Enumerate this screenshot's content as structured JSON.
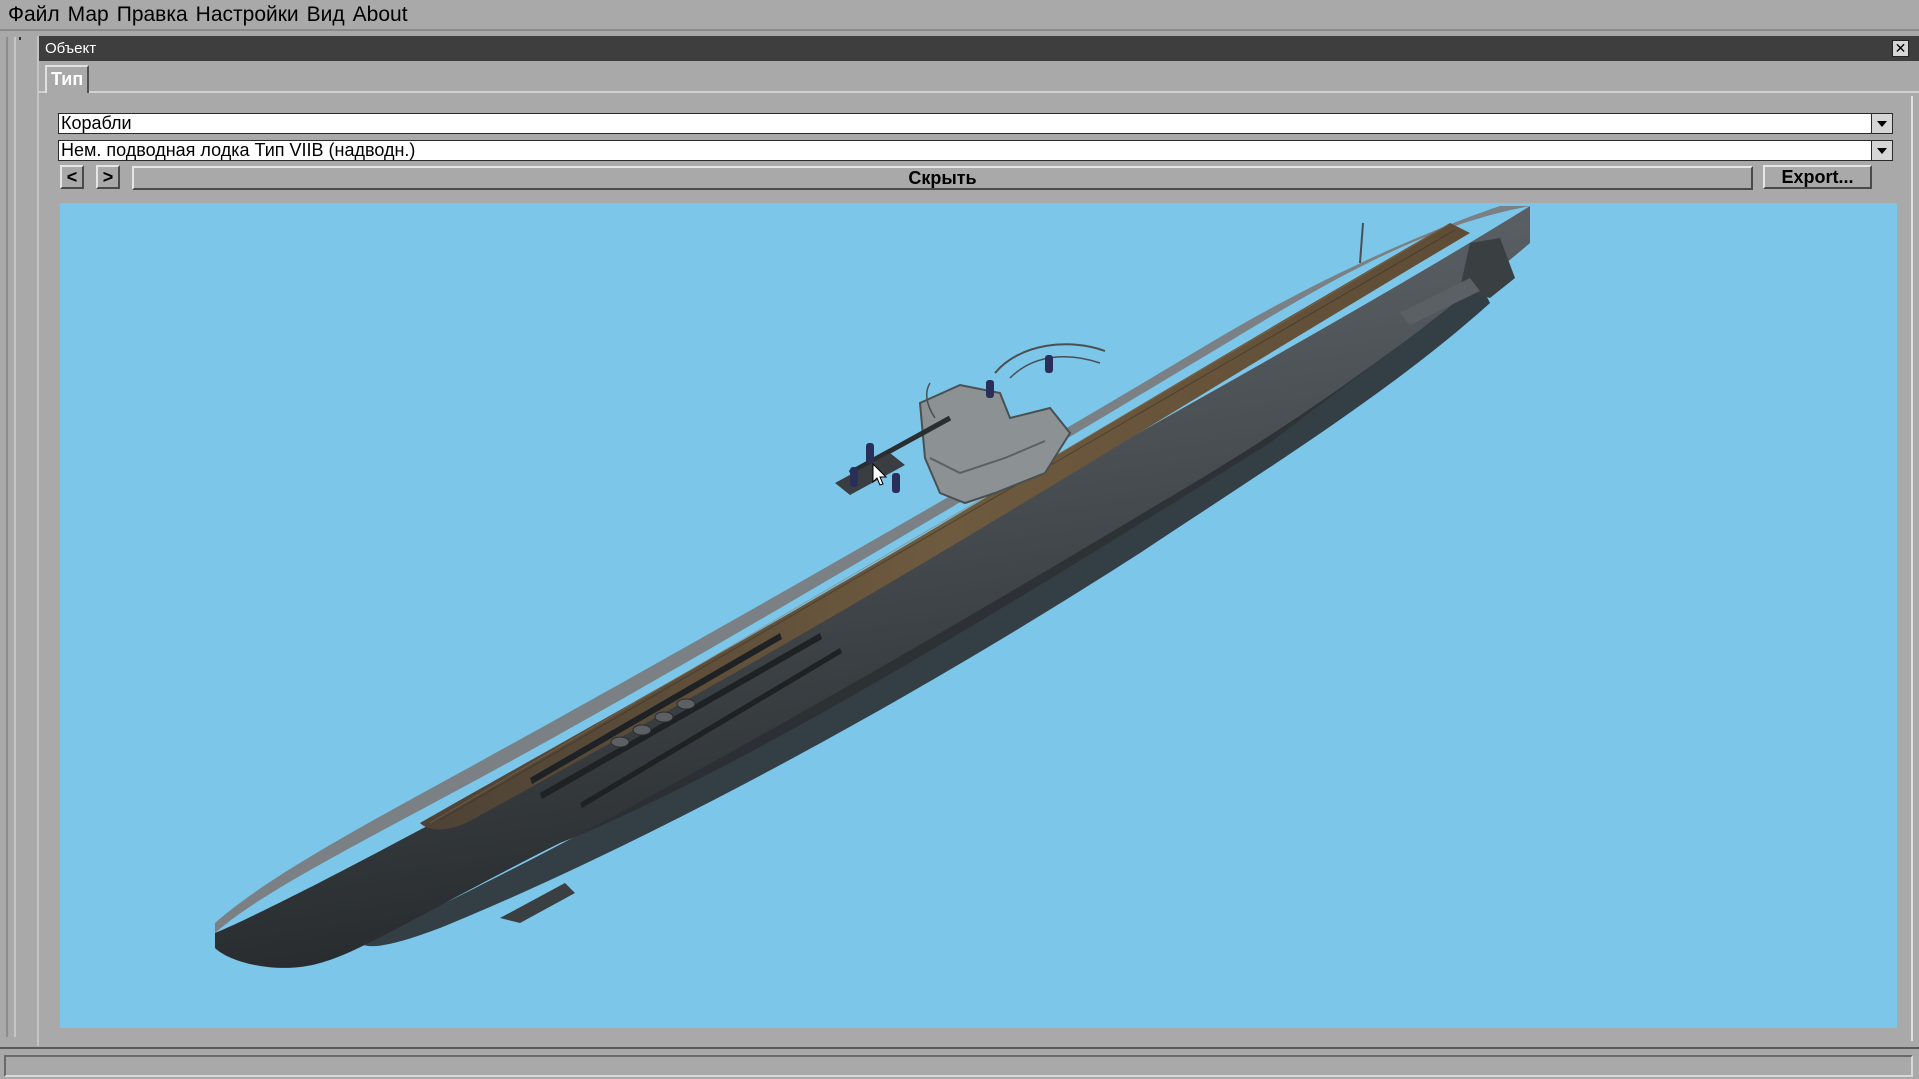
{
  "menubar": {
    "items": [
      "Файл",
      "Мар",
      "Правка",
      "Настройки",
      "Вид",
      "About"
    ]
  },
  "window": {
    "title": "Объект",
    "close_label": "✕",
    "tab_label": "Тип",
    "category_select": {
      "value": "Корабли"
    },
    "object_select": {
      "value": "Нем. подводная лодка Тип VIIB (надводн.)"
    },
    "prev_label": "<",
    "next_label": ">",
    "hide_label": "Скрыть",
    "export_label": "Export..."
  },
  "viewport": {
    "background": "#7cc6ea",
    "content": "submarine-3d-model"
  },
  "colors": {
    "menubar_bg": "#a9a9a9",
    "titlebar_bg": "#3e3e3e",
    "hull_gray": "#4a4f52",
    "deck_wood": "#6e5a3e"
  }
}
